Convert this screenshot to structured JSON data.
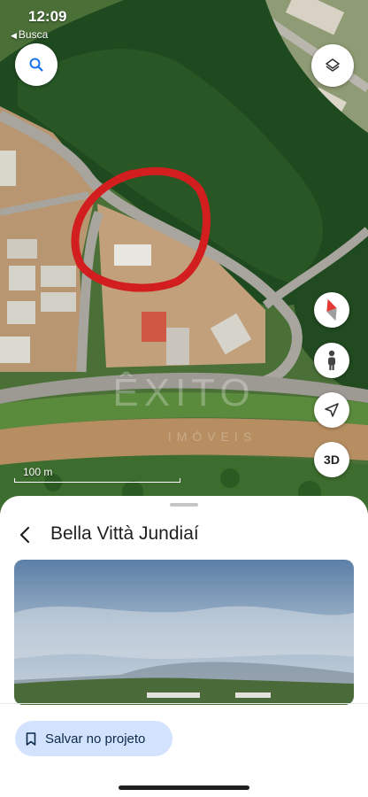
{
  "status_bar": {
    "time": "12:09",
    "back_to_app": "Busca"
  },
  "map": {
    "scale_label": "100 m",
    "watermark_text": "ÊXITO",
    "watermark_sub": "IMÓVEIS",
    "controls": {
      "search_icon": "search-icon",
      "layers_icon": "layers-icon",
      "compass_icon": "compass-icon",
      "street_view_icon": "pegman-icon",
      "location_icon": "navigation-arrow-icon",
      "three_d_label": "3D"
    }
  },
  "place": {
    "title": "Bella Vittà Jundiaí",
    "save_button_label": "Salvar no projeto"
  },
  "colors": {
    "accent_chip": "#d3e3fd",
    "marker_circle": "#d21e1e"
  }
}
